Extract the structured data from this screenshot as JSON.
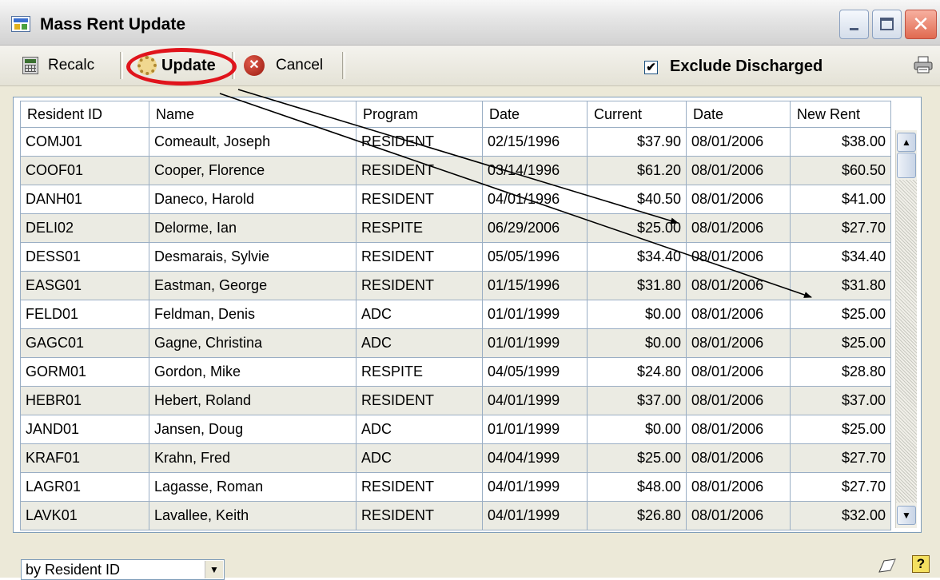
{
  "window": {
    "title": "Mass Rent Update",
    "controls": {
      "minimize_icon": "minimize-icon",
      "maximize_icon": "maximize-icon",
      "close_icon": "close-icon"
    }
  },
  "toolbar": {
    "recalc_label": "Recalc",
    "update_label": "Update",
    "cancel_label": "Cancel",
    "exclude_discharged_label": "Exclude Discharged",
    "exclude_discharged_checked": true,
    "check_mark": "✔"
  },
  "annotation": {
    "highlight_color": "#e0141c",
    "arrow_color": "#000000"
  },
  "grid": {
    "columns": [
      "Resident ID",
      "Name",
      "Program",
      "Date",
      "Current",
      "Date",
      "New Rent"
    ],
    "rows": [
      [
        "COMJ01",
        "Comeault, Joseph",
        "RESIDENT",
        "02/15/1996",
        "$37.90",
        "08/01/2006",
        "$38.00"
      ],
      [
        "COOF01",
        "Cooper, Florence",
        "RESIDENT",
        "03/14/1996",
        "$61.20",
        "08/01/2006",
        "$60.50"
      ],
      [
        "DANH01",
        "Daneco, Harold",
        "RESIDENT",
        "04/01/1996",
        "$40.50",
        "08/01/2006",
        "$41.00"
      ],
      [
        "DELI02",
        "Delorme, Ian",
        "RESPITE",
        "06/29/2006",
        "$25.00",
        "08/01/2006",
        "$27.70"
      ],
      [
        "DESS01",
        "Desmarais, Sylvie",
        "RESIDENT",
        "05/05/1996",
        "$34.40",
        "08/01/2006",
        "$34.40"
      ],
      [
        "EASG01",
        "Eastman, George",
        "RESIDENT",
        "01/15/1996",
        "$31.80",
        "08/01/2006",
        "$31.80"
      ],
      [
        "FELD01",
        "Feldman, Denis",
        "ADC",
        "01/01/1999",
        "$0.00",
        "08/01/2006",
        "$25.00"
      ],
      [
        "GAGC01",
        "Gagne, Christina",
        "ADC",
        "01/01/1999",
        "$0.00",
        "08/01/2006",
        "$25.00"
      ],
      [
        "GORM01",
        "Gordon, Mike",
        "RESPITE",
        "04/05/1999",
        "$24.80",
        "08/01/2006",
        "$28.80"
      ],
      [
        "HEBR01",
        "Hebert, Roland",
        "RESIDENT",
        "04/01/1999",
        "$37.00",
        "08/01/2006",
        "$37.00"
      ],
      [
        "JAND01",
        "Jansen, Doug",
        "ADC",
        "01/01/1999",
        "$0.00",
        "08/01/2006",
        "$25.00"
      ],
      [
        "KRAF01",
        "Krahn, Fred",
        "ADC",
        "04/04/1999",
        "$25.00",
        "08/01/2006",
        "$27.70"
      ],
      [
        "LAGR01",
        "Lagasse, Roman",
        "RESIDENT",
        "04/01/1999",
        "$48.00",
        "08/01/2006",
        "$27.70"
      ],
      [
        "LAVK01",
        "Lavallee, Keith",
        "RESIDENT",
        "04/01/1999",
        "$26.80",
        "08/01/2006",
        "$32.00"
      ]
    ]
  },
  "statusbar": {
    "sort_value": "by Resident ID",
    "dropdown_glyph": "▼",
    "help_glyph": "?"
  },
  "scrollbar": {
    "up_glyph": "▲",
    "down_glyph": "▼"
  }
}
